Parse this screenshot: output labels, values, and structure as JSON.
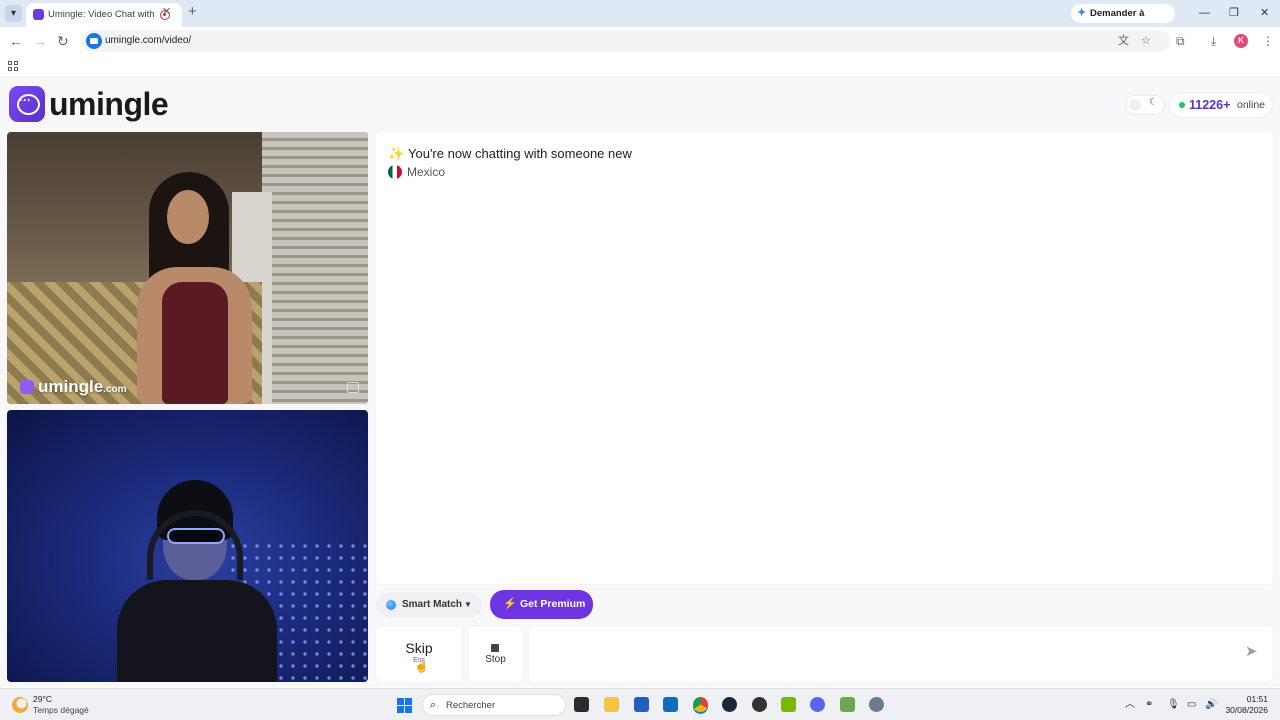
{
  "browser": {
    "tab_title": "Umingle: Video Chat with Strangers",
    "tab_close": "✕",
    "new_tab": "+",
    "gemini_label": "Demander à Gemini",
    "url": "umingle.com/video/",
    "profile_initial": "K",
    "window_controls": [
      "—",
      "❐",
      "✕"
    ]
  },
  "header": {
    "logo_text": "umingle",
    "online_count": "11226+",
    "online_label": "online"
  },
  "video": {
    "watermark_main": "umingle",
    "watermark_suffix": ".com"
  },
  "chat": {
    "status_message": "You're now chatting with someone new",
    "country": "Mexico"
  },
  "controls": {
    "smart_match_label": "Smart Match",
    "premium_label": "Get Premium",
    "skip_label": "Skip",
    "skip_hint": "Esc",
    "stop_label": "Stop",
    "message_placeholder": ""
  },
  "taskbar": {
    "temperature": "29°C",
    "weather": "Temps dégagé",
    "search_label": "Rechercher",
    "time": "01:51",
    "date": "30/08/2026"
  },
  "colors": {
    "brand_purple": "#6d35e0",
    "online_green": "#22c55e",
    "online_count": "#5b2fc9"
  },
  "icons": [
    "sparkle-icon",
    "mexico-flag-icon",
    "globe-icon",
    "bolt-icon",
    "send-icon",
    "stop-icon",
    "report-flag-icon",
    "moon-icon"
  ]
}
